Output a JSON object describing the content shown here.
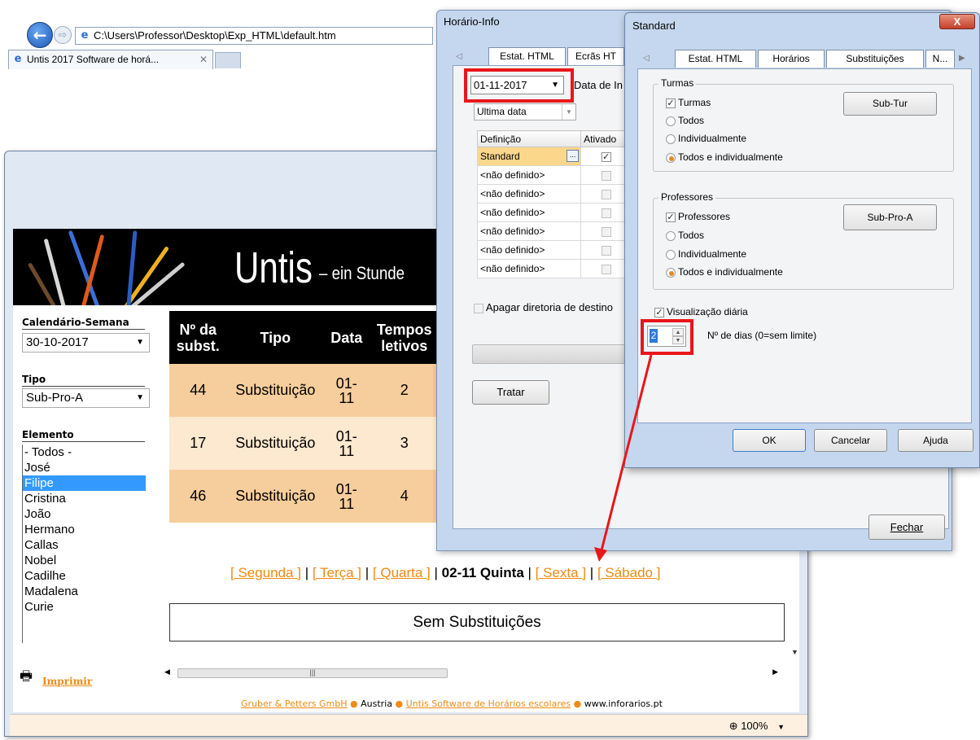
{
  "browser": {
    "address": "C:\\Users\\Professor\\Desktop\\Exp_HTML\\default.htm",
    "tab_title": "Untis 2017 Software de horá...",
    "tab_close": "✕",
    "back_icon": "←",
    "forward_icon": "⇨",
    "zoom": "100%"
  },
  "banner": {
    "title": "Untis",
    "subtitle": "– ein Stunde"
  },
  "sidebar": {
    "week_label": "Calendário-Semana",
    "week_value": "30-10-2017",
    "type_label": "Tipo",
    "type_value": "Sub-Pro-A",
    "element_label": "Elemento",
    "elements": [
      "- Todos -",
      "José",
      "Filipe",
      "Cristina",
      "João",
      "Hermano",
      "Callas",
      "Nobel",
      "Cadilhe",
      "Madalena",
      "Curie"
    ],
    "selected_element": "Filipe",
    "print_label": "Imprimir"
  },
  "table": {
    "headers": {
      "num_line1": "Nº da",
      "num_line2": "subst.",
      "tipo": "Tipo",
      "data": "Data",
      "tempos_line1": "Tempos",
      "tempos_line2": "letivos"
    },
    "rows": [
      {
        "num": "44",
        "tipo": "Substituição",
        "date_line1": "01-",
        "date_line2": "11",
        "tempo": "2"
      },
      {
        "num": "17",
        "tipo": "Substituição",
        "date_line1": "01-",
        "date_line2": "11",
        "tempo": "3"
      },
      {
        "num": "46",
        "tipo": "Substituição",
        "date_line1": "01-",
        "date_line2": "11",
        "tempo": "4"
      }
    ]
  },
  "day_nav": {
    "segunda": "[ Segunda ]",
    "terca": "[ Terça ]",
    "quarta": "[ Quarta ]",
    "current": "02-11 Quinta",
    "sexta": "[ Sexta ]",
    "sabado": "[ Sábado ]",
    "sep": "|"
  },
  "no_subst": "Sem Substituições",
  "footer": {
    "link1": "Gruber & Petters GmbH",
    "text1": "Austria",
    "link2": "Untis Software de Horários escolares",
    "text2": "www.inforarios.pt",
    "dot": "●"
  },
  "horario": {
    "title": "Horário-Info",
    "tab1": "Estat. HTML",
    "tab2": "Ecrãs HT",
    "date_value": "01-11-2017",
    "date_label": "Data de In",
    "ultima_value": "Ultima data",
    "grid_header_def": "Definição",
    "grid_header_ativado": "Ativado",
    "grid_rows": [
      "Standard",
      "<não definido>",
      "<não definido>",
      "<não definido>",
      "<não definido>",
      "<não definido>",
      "<não definido>"
    ],
    "apagar_label": "Apagar diretoria de destino",
    "tratar_label": "Tratar",
    "fechar_label": "Fechar"
  },
  "standard": {
    "title": "Standard",
    "close_label": "X",
    "tabs": [
      "Estat. HTML",
      "Horários",
      "Substituições",
      "N..."
    ],
    "turmas_group": "Turmas",
    "turmas_check": "Turmas",
    "turmas_todos": "Todos",
    "turmas_indiv": "Individualmente",
    "turmas_both": "Todos e individualmente",
    "sub_tur_button": "Sub-Tur",
    "prof_group": "Professores",
    "prof_check": "Professores",
    "prof_todos": "Todos",
    "prof_indiv": "Individualmente",
    "prof_both": "Todos e individualmente",
    "sub_pro_button": "Sub-Pro-A",
    "vis_diaria": "Visualização diária",
    "ndias_value": "2",
    "ndias_label": "Nº de dias (0=sem limite)",
    "ok": "OK",
    "cancel": "Cancelar",
    "help": "Ajuda"
  },
  "colors": {
    "accent": "#f08a14",
    "selection": "#3399ff",
    "annotation": "#e8161a",
    "row_dark": "#f6cd9c",
    "row_light": "#fde8d0"
  }
}
